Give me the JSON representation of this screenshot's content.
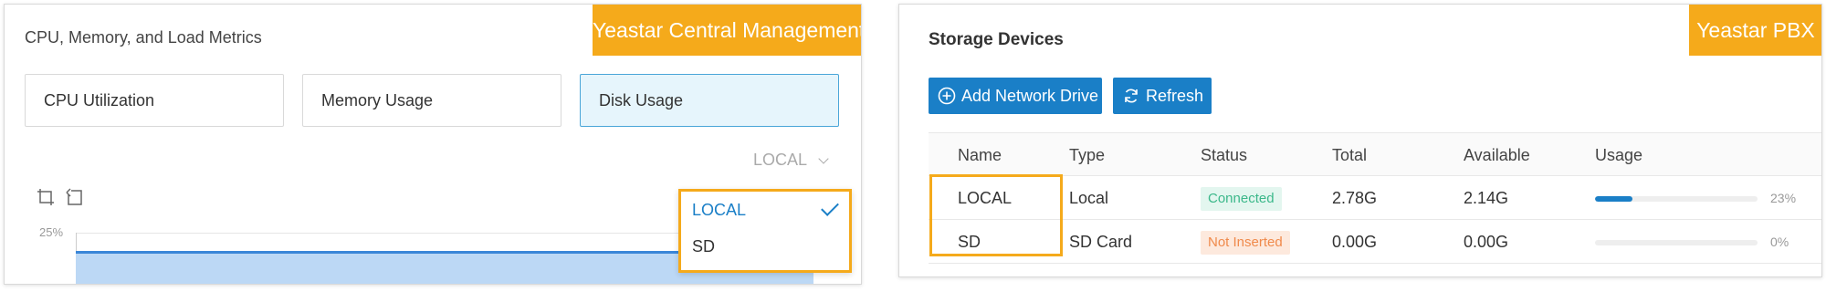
{
  "left": {
    "banner": "Yeastar Central Management",
    "title": "CPU, Memory, and Load Metrics",
    "tabs": [
      {
        "label": "CPU Utilization",
        "active": false
      },
      {
        "label": "Memory Usage",
        "active": false
      },
      {
        "label": "Disk Usage",
        "active": true
      }
    ],
    "select_value": "LOCAL",
    "y_tick": "25%",
    "dropdown_options": [
      {
        "label": "LOCAL",
        "selected": true
      },
      {
        "label": "SD",
        "selected": false
      }
    ]
  },
  "right": {
    "banner": "Yeastar PBX",
    "title": "Storage Devices",
    "buttons": {
      "add": "Add Network Drive",
      "refresh": "Refresh"
    },
    "columns": [
      "Name",
      "Type",
      "Status",
      "Total",
      "Available",
      "Usage"
    ],
    "rows": [
      {
        "name": "LOCAL",
        "type": "Local",
        "status": "Connected",
        "total": "2.78G",
        "available": "2.14G",
        "usage_pct": "23%",
        "usage": 0.23
      },
      {
        "name": "SD",
        "type": "SD Card",
        "status": "Not Inserted",
        "total": "0.00G",
        "available": "0.00G",
        "usage_pct": "0%",
        "usage": 0
      }
    ]
  },
  "colors": {
    "accent": "#f5aa1b",
    "primary": "#1a7fc7",
    "ok": "#3bb88a",
    "warn": "#f08a4b"
  }
}
